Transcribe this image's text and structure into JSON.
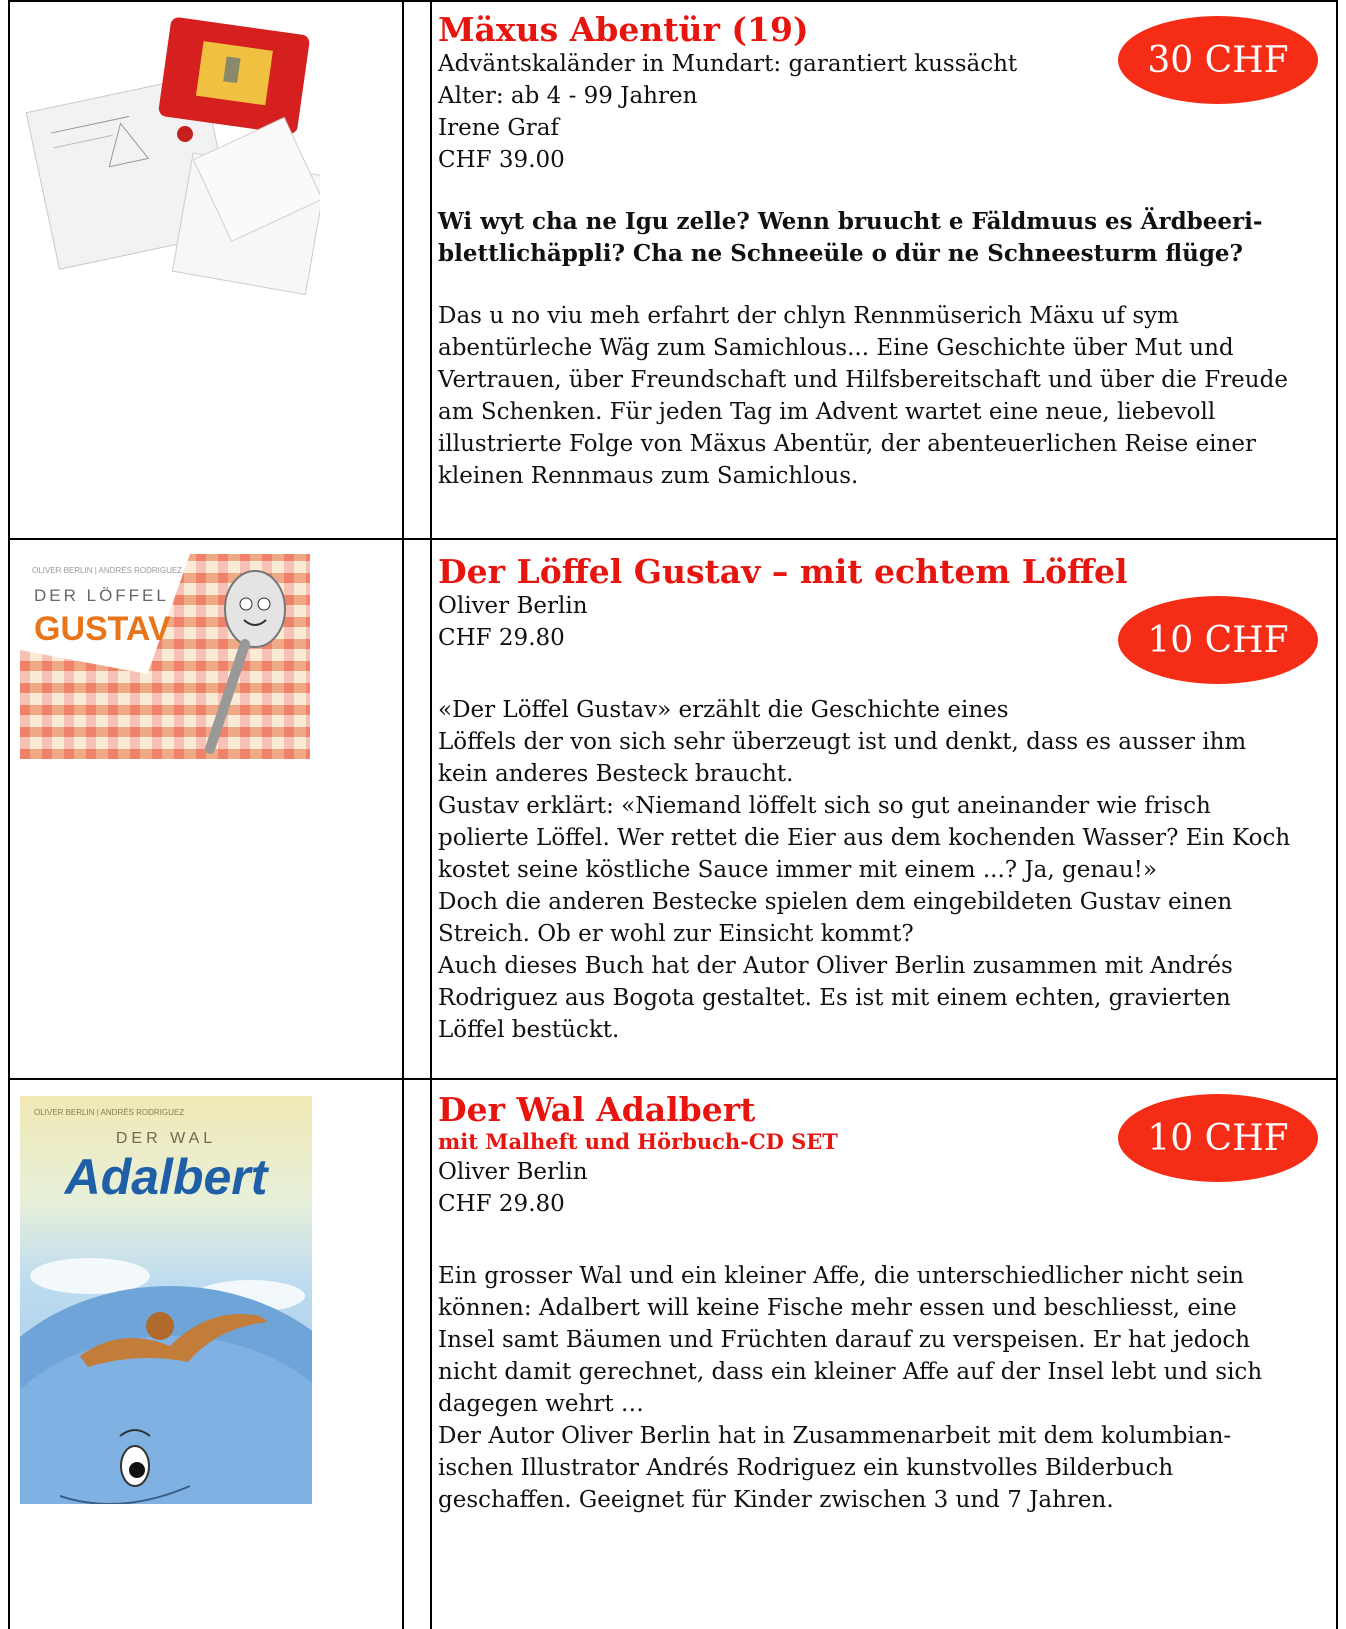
{
  "books": [
    {
      "title": "Mäxus Abentür (19)",
      "lines": [
        "Adväntskaländer in Mundart: garantiert kussächt",
        "Alter: ab 4 - 99 Jahren",
        "Irene Graf",
        "CHF 39.00"
      ],
      "price_badge": "30 CHF",
      "teaser": "Wi wyt cha ne Igu zelle? Wenn bruucht e Fäldmuus es Ärdbeeri-blettlichäppli? Cha ne Schneeüle o dür ne Schneesturm flüge?",
      "description": "Das u no viu meh erfahrt der chlyn Rennmüserich Mäxu uf sym abentürleche Wäg zum Samichlous... Eine Geschichte über Mut und Vertrauen, über Freundschaft und Hilfsbereitschaft und über die Freude am Schenken. Für jeden Tag im Advent wartet eine neue, liebevoll illustrierte Folge von Mäxus Abentür, der abenteuerlichen Reise einer kleinen Rennmaus zum Samichlous."
    },
    {
      "title": "Der Löffel Gustav – mit echtem Löffel",
      "lines": [
        "Oliver Berlin",
        "CHF 29.80"
      ],
      "price_badge": "10 CHF",
      "cover_authors": "OLIVER BERLIN | ANDRÉS RODRIGUEZ",
      "cover_title_top": "DER LÖFFEL",
      "cover_title_main": "GUSTAV",
      "description_lines": [
        "«Der Löffel Gustav» erzählt die Geschichte eines",
        "Löffels der von sich sehr überzeugt ist und denkt, dass es ausser ihm kein anderes Besteck braucht.",
        "Gustav erklärt: «Niemand löffelt sich so gut aneinander wie frisch polierte Löffel. Wer rettet die Eier aus dem kochenden Wasser? Ein Koch kostet seine köstliche Sauce immer mit einem ...? Ja, genau!»",
        "Doch die anderen Bestecke spielen dem eingebildeten Gustav einen Streich. Ob er wohl zur Einsicht kommt?",
        "Auch dieses Buch hat der Autor Oliver Berlin zusammen mit Andrés Rodriguez aus Bogota gestaltet. Es ist mit einem echten, gravierten Löffel bestückt."
      ]
    },
    {
      "title": "Der Wal Adalbert",
      "subtitle": "mit Malheft und Hörbuch-CD SET",
      "lines": [
        "Oliver Berlin",
        "CHF 29.80"
      ],
      "price_badge": "10 CHF",
      "cover_authors": "OLIVER BERLIN | ANDRÉS RODRIGUEZ",
      "cover_title_top": "DER WAL",
      "cover_title_main": "Adalbert",
      "description_lines": [
        "Ein grosser Wal und ein kleiner Affe, die unterschiedlicher nicht sein können: Adalbert will keine Fische mehr essen und beschliesst, eine Insel samt Bäumen und Früchten darauf zu verspeisen. Er hat jedoch nicht damit gerechnet, dass ein kleiner Affe auf der Insel lebt und sich dagegen wehrt …",
        "Der Autor Oliver Berlin hat in Zusammenarbeit mit dem kolumbian-ischen Illustrator Andrés Rodriguez ein kunstvolles Bilderbuch geschaffen. Geeignet für Kinder zwischen 3 und 7 Jahren."
      ]
    }
  ]
}
